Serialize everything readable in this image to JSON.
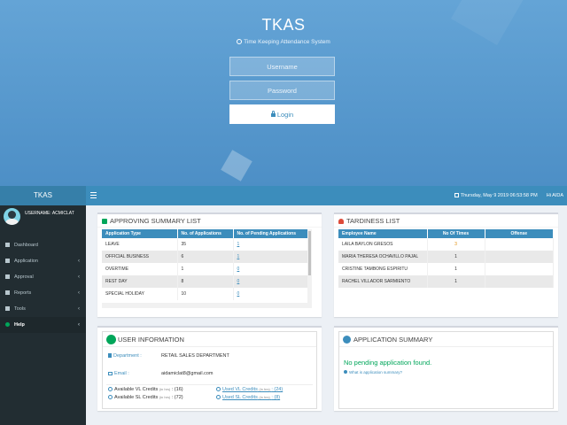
{
  "login": {
    "app_title": "TKAS",
    "subtitle": "Time Keeping Attendance System",
    "username_placeholder": "Username",
    "password_placeholder": "Password",
    "login_label": "Login"
  },
  "header": {
    "brand": "TKAS",
    "datetime": "Thursday, May 9 2019 06:53:58 PM",
    "greeting": "Hi AIDA"
  },
  "sidebar": {
    "user_label": "USERNAME: ACMICLAT",
    "items": [
      {
        "label": "Dashboard",
        "chevron": ""
      },
      {
        "label": "Application",
        "chevron": "‹"
      },
      {
        "label": "Approval",
        "chevron": "‹"
      },
      {
        "label": "Reports",
        "chevron": "‹"
      },
      {
        "label": "Tools",
        "chevron": "‹"
      },
      {
        "label": "Help",
        "chevron": "‹"
      }
    ]
  },
  "approving": {
    "title": "APPROVING SUMMARY LIST",
    "headers": [
      "Application Type",
      "No. of Applications",
      "No. of Pending Applications"
    ],
    "rows": [
      [
        "LEAVE",
        "35",
        "1"
      ],
      [
        "OFFICIAL BUSINESS",
        "6",
        "1"
      ],
      [
        "OVERTIME",
        "1",
        "0"
      ],
      [
        "REST DAY",
        "8",
        "0"
      ],
      [
        "SPECIAL HOLIDAY",
        "10",
        "0"
      ]
    ]
  },
  "tardiness": {
    "title": "TARDINESS LIST",
    "headers": [
      "Employee Name",
      "No Of Times",
      "Offense"
    ],
    "rows": [
      [
        "LAILA BAYLON GRESOS",
        "3",
        ""
      ],
      [
        "MARIA THERESA OCHAVILLO PAJAL",
        "1",
        ""
      ],
      [
        "CRISTINE TAMBONG ESPIRITU",
        "1",
        ""
      ],
      [
        "RACHEL VILLADOR SARMIENTO",
        "1",
        ""
      ]
    ]
  },
  "user_info": {
    "title": "USER INFORMATION",
    "department_label": "Department :",
    "department_value": "RETAIL SALES DEPARTMENT",
    "email_label": "Email :",
    "email_value": "aidamiclat8@gmail.com",
    "vl_available": "Available VL Credits",
    "vl_available_unit": "(in hrs)",
    "vl_available_value": ": (16)",
    "sl_available": "Available SL Credits",
    "sl_available_unit": "(in hrs)",
    "sl_available_value": ": (72)",
    "vl_used": "Used VL Credits",
    "vl_used_unit": "(in hrs)",
    "vl_used_value": ": (24)",
    "sl_used": "Used SL Credits",
    "sl_used_unit": "(in hrs)",
    "sl_used_value": ": (8)"
  },
  "app_summary": {
    "title": "APPLICATION SUMMARY",
    "message": "No pending application found.",
    "help_link": "What is application summary?"
  },
  "colors": {
    "primary": "#3c8dbc",
    "sidebar": "#222d32",
    "success": "#00a65a"
  }
}
